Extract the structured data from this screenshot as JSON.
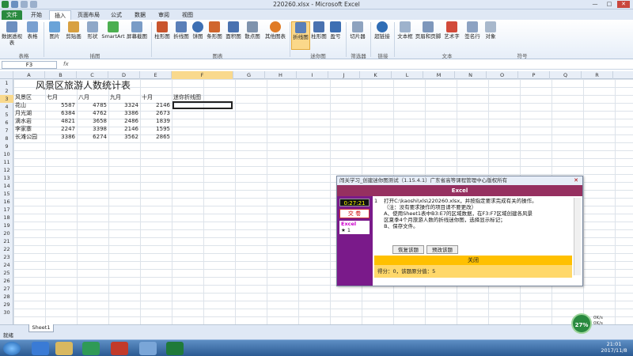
{
  "window": {
    "title": "220260.xlsx - Microsoft Excel",
    "controls": [
      "—",
      "□",
      "✕"
    ]
  },
  "tabs": [
    {
      "label": "文件",
      "active": false,
      "file": true
    },
    {
      "label": "开始",
      "active": false
    },
    {
      "label": "插入",
      "active": true
    },
    {
      "label": "页面布局",
      "active": false
    },
    {
      "label": "公式",
      "active": false
    },
    {
      "label": "数据",
      "active": false
    },
    {
      "label": "审阅",
      "active": false
    },
    {
      "label": "视图",
      "active": false
    }
  ],
  "ribbon": {
    "buttons": [
      {
        "label": "数据透视表",
        "icon": "pivot-table-icon"
      },
      {
        "label": "表格",
        "icon": "table-icon"
      },
      {
        "label": "图片",
        "icon": "picture-icon"
      },
      {
        "label": "剪贴画",
        "icon": "clipart-icon"
      },
      {
        "label": "形状",
        "icon": "shapes-icon"
      },
      {
        "label": "SmartArt",
        "icon": "smartart-icon"
      },
      {
        "label": "屏幕截图",
        "icon": "screenshot-icon"
      },
      {
        "label": "柱形图",
        "icon": "column-chart-icon"
      },
      {
        "label": "折线图",
        "icon": "line-chart-icon"
      },
      {
        "label": "饼图",
        "icon": "pie-chart-icon"
      },
      {
        "label": "条形图",
        "icon": "bar-chart-icon"
      },
      {
        "label": "面积图",
        "icon": "area-chart-icon"
      },
      {
        "label": "散点图",
        "icon": "scatter-chart-icon"
      },
      {
        "label": "其他图表",
        "icon": "other-chart-icon"
      },
      {
        "label": "折线图",
        "icon": "sparkline-line-icon"
      },
      {
        "label": "柱形图",
        "icon": "sparkline-column-icon"
      },
      {
        "label": "盈亏",
        "icon": "sparkline-winloss-icon"
      },
      {
        "label": "切片器",
        "icon": "slicer-icon"
      },
      {
        "label": "超链接",
        "icon": "hyperlink-icon"
      },
      {
        "label": "文本框",
        "icon": "textbox-icon"
      },
      {
        "label": "页眉和页脚",
        "icon": "header-footer-icon"
      },
      {
        "label": "艺术字",
        "icon": "wordart-icon"
      },
      {
        "label": "签名行",
        "icon": "signature-icon"
      },
      {
        "label": "对象",
        "icon": "object-icon"
      }
    ],
    "groups": [
      "表格",
      "插图",
      "图表",
      "迷你图",
      "筛选器",
      "链接",
      "文本",
      "符号"
    ]
  },
  "formula_bar": {
    "name_box": "F3",
    "fx": "fx",
    "value": ""
  },
  "columns": [
    "A",
    "B",
    "C",
    "D",
    "E",
    "F",
    "G",
    "H",
    "I",
    "J",
    "K",
    "L",
    "M",
    "N",
    "O",
    "P",
    "Q",
    "R"
  ],
  "rows": [
    "1",
    "2",
    "3",
    "4",
    "5",
    "6",
    "7",
    "8",
    "9",
    "10",
    "11",
    "12",
    "13",
    "14",
    "15",
    "16",
    "17",
    "18",
    "19",
    "20",
    "21",
    "22",
    "23",
    "24",
    "25",
    "26",
    "27",
    "28",
    "29",
    "30"
  ],
  "sheet": {
    "title": "风景区旅游人数统计表",
    "headers": [
      "风景区",
      "七月",
      "八月",
      "九月",
      "十月",
      "迷你折线图"
    ],
    "data": [
      [
        "花山",
        "5587",
        "4785",
        "3324",
        "2146"
      ],
      [
        "月光湖",
        "6384",
        "4762",
        "3386",
        "2673"
      ],
      [
        "滴水岩",
        "4821",
        "3658",
        "2486",
        "1839"
      ],
      [
        "李家寨",
        "2247",
        "3398",
        "2146",
        "1595"
      ],
      [
        "长滩公园",
        "3386",
        "6274",
        "3562",
        "2865"
      ]
    ]
  },
  "sheet_tab": "Sheet1",
  "status": {
    "ready": "就绪"
  },
  "dialog": {
    "title": "闯关学习_创建迷你图测试（1.15.4.1）广东省高等课程管理中心版权所有",
    "band": "Excel",
    "timer": "0:27:21",
    "submit": "交 卷",
    "question_header": "Excel",
    "question_item": "1",
    "question_no": "1",
    "content": [
      "打开C:\\kaoshi\\xls\\220260.xlsx，并按指定要求完成有关的操作。",
      "（注：没有要求操作的项目请不要更改）",
      "A、使用Sheet1表中B3:E7的区域数据，在F3:F7区域创建各风景",
      "区夏季4个月旅游人数的折线迷你图，选择显示标记；",
      "B、保存文件。"
    ],
    "btn_restore": "恢复该题",
    "btn_redo": "预改该题",
    "close": "关闭",
    "score": "得分：0，该题原分值：5"
  },
  "net": {
    "percent": "27%",
    "up": "0K/s",
    "down": "0K/s"
  },
  "clock": {
    "time": "21:01",
    "date": "2017/11/8"
  }
}
